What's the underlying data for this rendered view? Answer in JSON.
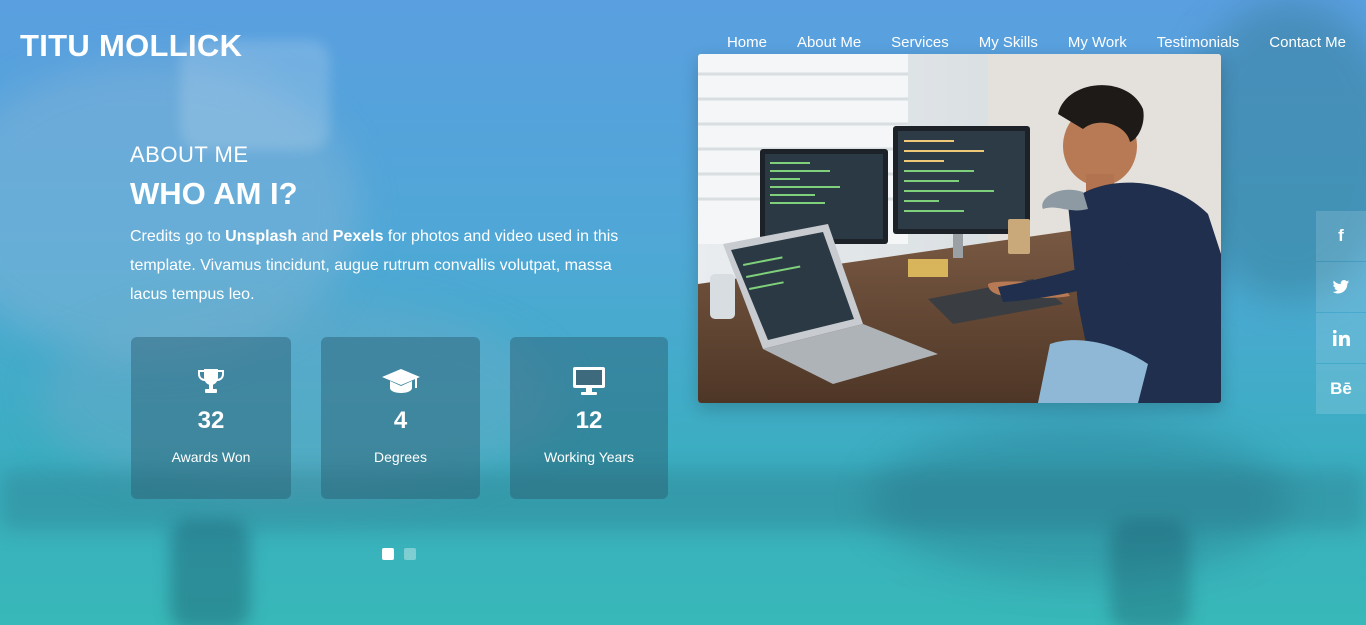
{
  "site": {
    "logo": "TITU MOLLICK"
  },
  "nav": {
    "items": [
      "Home",
      "About Me",
      "Services",
      "My Skills",
      "My Work",
      "Testimonials",
      "Contact Me"
    ]
  },
  "about": {
    "subtitle": "ABOUT ME",
    "title": "WHO AM I?",
    "intro_pre": "Credits go to ",
    "intro_b1": "Unsplash",
    "intro_mid": " and ",
    "intro_b2": "Pexels",
    "intro_post": " for photos and video used in this template. Vivamus tincidunt, augue rutrum convallis volutpat, massa lacus tempus leo."
  },
  "stats": [
    {
      "icon": "trophy-icon",
      "number": "32",
      "label": "Awards Won"
    },
    {
      "icon": "graduation-cap-icon",
      "number": "4",
      "label": "Degrees"
    },
    {
      "icon": "monitor-icon",
      "number": "12",
      "label": "Working Years"
    }
  ],
  "carousel": {
    "active_index": 0,
    "count": 2
  },
  "social": {
    "facebook": "f",
    "behance": "Bē"
  },
  "colors": {
    "accent": "#ffffff",
    "bg_top": "#5a9fe0",
    "bg_bottom": "#38b8b8"
  }
}
